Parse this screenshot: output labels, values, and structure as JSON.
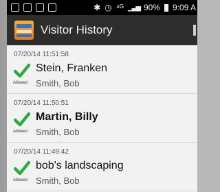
{
  "status_bar": {
    "battery_pct": "90%",
    "time": "9:09 A"
  },
  "app_bar": {
    "title": "Visitor History"
  },
  "visits": [
    {
      "timestamp": "07/20/14 11:51:58",
      "visitor": "Stein, Franken",
      "status": "Allowed",
      "host": "Smith, Bob"
    },
    {
      "timestamp": "07/20/14 11:50:51",
      "visitor": "Martin, Billy",
      "status": "Allowed",
      "host": "Smith, Bob"
    },
    {
      "timestamp": "07/20/14 11:49:42",
      "visitor": "bob's landscaping",
      "status": "Allowed",
      "host": "Smith, Bob"
    }
  ],
  "icons": {
    "status_left": [
      "notification-icon",
      "image-icon",
      "mail-icon",
      "briefcase-icon"
    ],
    "status_right": [
      "bluetooth-icon",
      "alarm-icon",
      "network-icon",
      "signal-icon",
      "battery-icon"
    ],
    "entry": "checkmark-icon"
  },
  "colors": {
    "check": "#2eaa3a",
    "app_bar": "#2d2d2d"
  }
}
